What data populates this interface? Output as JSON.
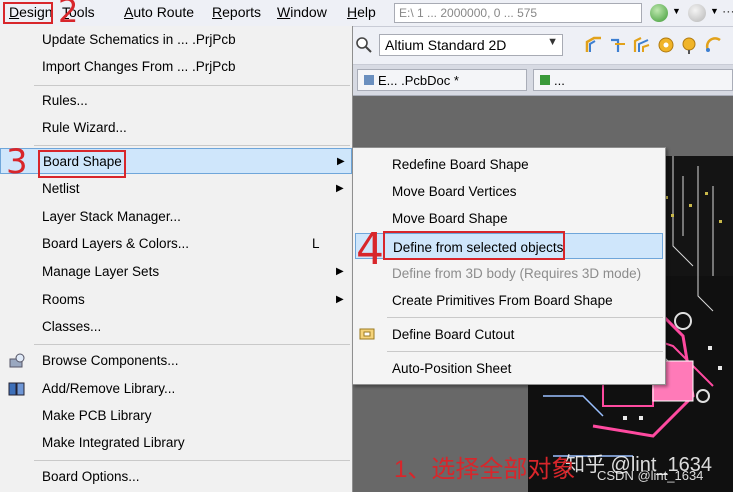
{
  "menubar": {
    "items": [
      "Design",
      "Tools",
      "Auto Route",
      "Reports",
      "Window",
      "Help"
    ],
    "address": "E:\\ 1 ... 2000000, 0 ... 575"
  },
  "toolbar": {
    "view_combo": "Altium Standard 2D"
  },
  "tabs": [
    "E... .PcbDoc *",
    "..."
  ],
  "design_menu": {
    "items": [
      {
        "label": "Update Schematics in ... .PrjPcb"
      },
      {
        "label": "Import Changes From ... .PrjPcb"
      },
      {
        "label": "Rules..."
      },
      {
        "label": "Rule Wizard..."
      },
      {
        "label": "Board Shape"
      },
      {
        "label": "Netlist"
      },
      {
        "label": "Layer Stack Manager..."
      },
      {
        "label": "Board Layers & Colors...",
        "shortcut": "L"
      },
      {
        "label": "Manage Layer Sets"
      },
      {
        "label": "Rooms"
      },
      {
        "label": "Classes..."
      },
      {
        "label": "Browse Components..."
      },
      {
        "label": "Add/Remove Library..."
      },
      {
        "label": "Make PCB Library"
      },
      {
        "label": "Make Integrated Library"
      },
      {
        "label": "Board Options..."
      }
    ]
  },
  "board_shape_menu": {
    "items": [
      {
        "label": "Redefine Board Shape"
      },
      {
        "label": "Move Board Vertices"
      },
      {
        "label": "Move Board Shape"
      },
      {
        "label": "Define from selected objects"
      },
      {
        "label": "Define from 3D body (Requires 3D mode)"
      },
      {
        "label": "Create Primitives From Board Shape"
      },
      {
        "label": "Define Board Cutout"
      },
      {
        "label": "Auto-Position Sheet"
      }
    ]
  },
  "annotations": {
    "step1": "1、选择全部对象",
    "step2": "2",
    "step3": "3",
    "step4": "4",
    "color": "#d8262b"
  },
  "watermark": {
    "zhihu": "知乎 @lint_1634",
    "csdn": "CSDN @lint_1634"
  }
}
